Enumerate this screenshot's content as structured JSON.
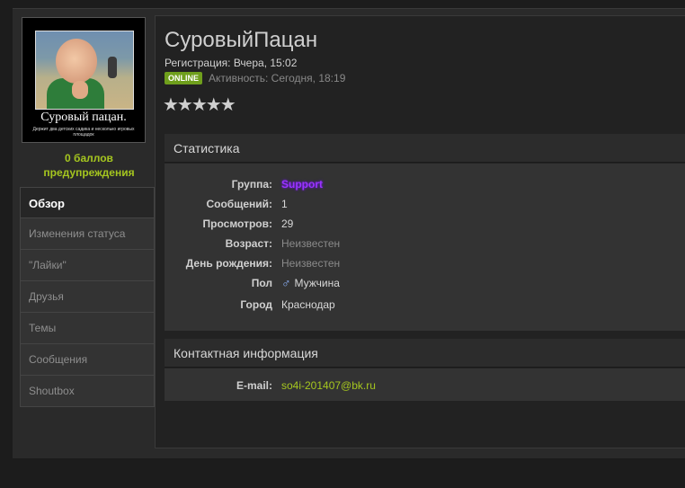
{
  "profile": {
    "username": "СуровыйПацан",
    "registration": "Регистрация: Вчера, 15:02",
    "online_badge": "ONLINE",
    "activity": "Активность: Сегодня, 18:19",
    "rating_stars": "★★★★★",
    "avatar_caption": "Суровый пацан.",
    "avatar_subcaption": "Держит два детских садика и несколько игровых площадок",
    "warnings": "0 баллов предупреждения"
  },
  "sidebar": {
    "items": [
      {
        "label": "Обзор",
        "active": true
      },
      {
        "label": "Изменения статуса"
      },
      {
        "label": "\"Лайки\""
      },
      {
        "label": "Друзья"
      },
      {
        "label": "Темы"
      },
      {
        "label": "Сообщения"
      },
      {
        "label": "Shoutbox"
      }
    ]
  },
  "stats": {
    "title": "Статистика",
    "group_label": "Группа:",
    "group_value": "Support",
    "posts_label": "Сообщений:",
    "posts_value": "1",
    "views_label": "Просмотров:",
    "views_value": "29",
    "age_label": "Возраст:",
    "age_value": "Неизвестен",
    "birthday_label": "День рождения:",
    "birthday_value": "Неизвестен",
    "gender_label": "Пол",
    "gender_value": "Мужчина",
    "city_label": "Город",
    "city_value": "Краснодар"
  },
  "contacts": {
    "title": "Контактная информация",
    "email_label": "E-mail:",
    "email_value": "so4i-201407@bk.ru"
  },
  "icons": {
    "gender": "male-icon"
  },
  "colors": {
    "accent_green": "#a5c61f",
    "group_purple": "#9b33ff",
    "online_badge": "#6f9f1c"
  }
}
